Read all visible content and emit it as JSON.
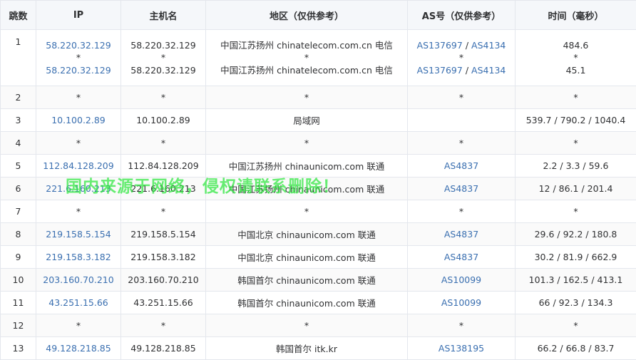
{
  "headers": {
    "hop": "跳数",
    "ip": "IP",
    "host": "主机名",
    "area": "地区（仅供参考）",
    "as": "AS号（仅供参考）",
    "time": "时间（毫秒）"
  },
  "watermark": "国内来源于网络，侵权请联系删除！",
  "rows": [
    {
      "hop": "1",
      "ip": [
        "58.220.32.129",
        "*",
        "58.220.32.129"
      ],
      "host": [
        "58.220.32.129",
        "*",
        "58.220.32.129"
      ],
      "area": [
        "中国江苏扬州 chinatelecom.com.cn 电信",
        "*",
        "中国江苏扬州 chinatelecom.com.cn 电信"
      ],
      "as": [
        [
          "AS137697",
          "AS4134"
        ],
        [
          "*"
        ],
        [
          "AS137697",
          "AS4134"
        ]
      ],
      "time": [
        "484.6",
        "*",
        "45.1"
      ]
    },
    {
      "hop": "2",
      "ip": "*",
      "host": "*",
      "area": "*",
      "as": "*",
      "time": "*"
    },
    {
      "hop": "3",
      "ip": "10.100.2.89",
      "host": "10.100.2.89",
      "area": "局域网",
      "as": "",
      "time": "539.7 / 790.2 / 1040.4"
    },
    {
      "hop": "4",
      "ip": "*",
      "host": "*",
      "area": "*",
      "as": "*",
      "time": "*"
    },
    {
      "hop": "5",
      "ip": "112.84.128.209",
      "host": "112.84.128.209",
      "area": "中国江苏扬州 chinaunicom.com 联通",
      "as": "AS4837",
      "time": "2.2 / 3.3 / 59.6"
    },
    {
      "hop": "6",
      "ip": "221.6.160.213",
      "host": "221.6.160.213",
      "area": "中国江苏扬州 chinaunicom.com 联通",
      "as": "AS4837",
      "time": "12 / 86.1 / 201.4"
    },
    {
      "hop": "7",
      "ip": "*",
      "host": "*",
      "area": "*",
      "as": "*",
      "time": "*"
    },
    {
      "hop": "8",
      "ip": "219.158.5.154",
      "host": "219.158.5.154",
      "area": "中国北京 chinaunicom.com 联通",
      "as": "AS4837",
      "time": "29.6 / 92.2 / 180.8"
    },
    {
      "hop": "9",
      "ip": "219.158.3.182",
      "host": "219.158.3.182",
      "area": "中国北京 chinaunicom.com 联通",
      "as": "AS4837",
      "time": "30.2 / 81.9 / 662.9"
    },
    {
      "hop": "10",
      "ip": "203.160.70.210",
      "host": "203.160.70.210",
      "area": "韩国首尔 chinaunicom.com 联通",
      "as": "AS10099",
      "time": "101.3 / 162.5 / 413.1"
    },
    {
      "hop": "11",
      "ip": "43.251.15.66",
      "host": "43.251.15.66",
      "area": "韩国首尔 chinaunicom.com 联通",
      "as": "AS10099",
      "time": "66 / 92.3 / 134.3"
    },
    {
      "hop": "12",
      "ip": "*",
      "host": "*",
      "area": "*",
      "as": "*",
      "time": "*"
    },
    {
      "hop": "13",
      "ip": "49.128.218.85",
      "host": "49.128.218.85",
      "area": "韩国首尔 itk.kr",
      "as": "AS138195",
      "time": "66.2 / 66.8 / 83.7"
    }
  ],
  "colors": {
    "link": "#3a6fb0",
    "header_bg": "#f5f7fa",
    "border": "#e4e7ed",
    "watermark": "#2ee83f"
  }
}
